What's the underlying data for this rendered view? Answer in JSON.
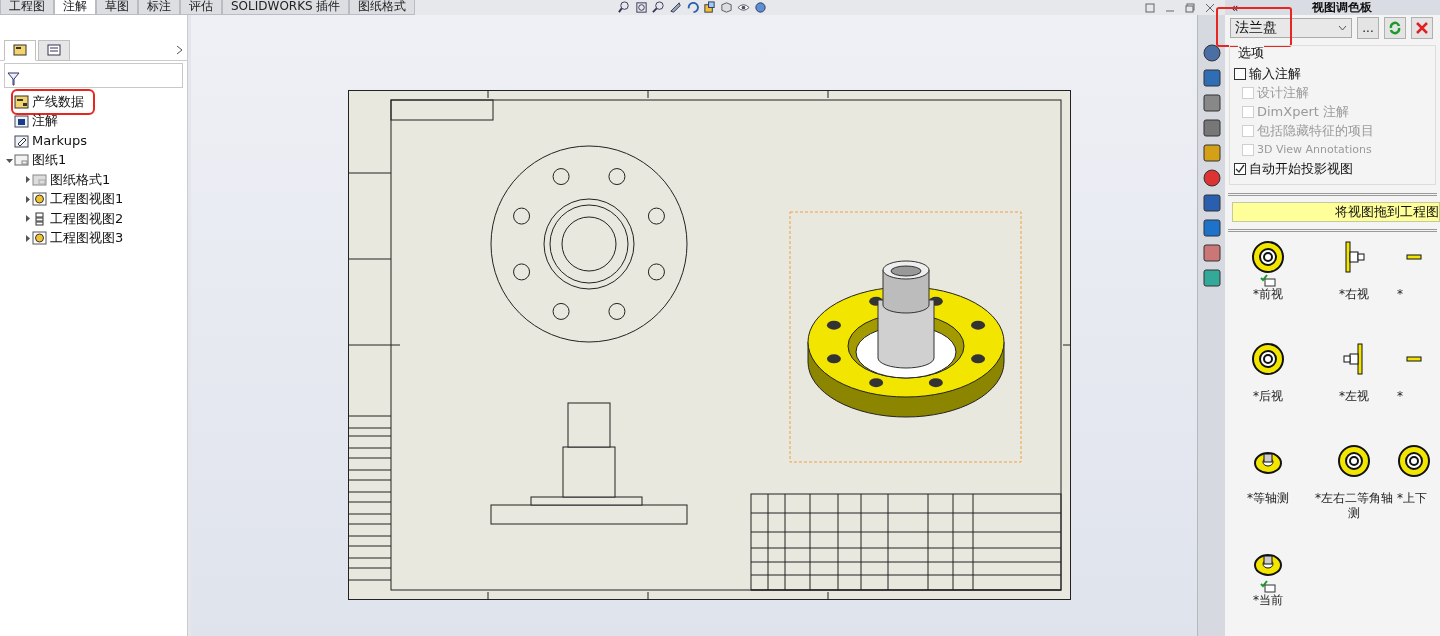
{
  "command_tabs": [
    {
      "label": "工程图",
      "selected": false
    },
    {
      "label": "注解",
      "selected": true
    },
    {
      "label": "草图",
      "selected": false
    },
    {
      "label": "标注",
      "selected": false
    },
    {
      "label": "评估",
      "selected": false
    },
    {
      "label": "SOLIDWORKS 插件",
      "selected": false
    },
    {
      "label": "图纸格式",
      "selected": false
    }
  ],
  "feature_manager": {
    "tabs": [
      {
        "kind": "feature",
        "selected": true
      },
      {
        "kind": "property",
        "selected": false
      }
    ],
    "tree": [
      {
        "label": "产线数据",
        "kind": "drawing",
        "highlighted": true
      },
      {
        "label": "注解",
        "kind": "annotation"
      },
      {
        "label": "Markups",
        "kind": "markup"
      },
      {
        "label": "图纸1",
        "kind": "sheet",
        "expanded": true,
        "children": [
          {
            "label": "图纸格式1",
            "kind": "format",
            "expanded": false
          },
          {
            "label": "工程图视图1",
            "kind": "view",
            "expanded": false
          },
          {
            "label": "工程图视图2",
            "kind": "section",
            "expanded": false
          },
          {
            "label": "工程图视图3",
            "kind": "view",
            "expanded": false
          }
        ]
      }
    ]
  },
  "view_palette": {
    "title": "视图调色板",
    "collapse": "«",
    "model": {
      "value": "法兰盘",
      "highlighted": true
    },
    "browse": "...",
    "options_title": "选项",
    "options": [
      {
        "label": "输入注解",
        "checked": false,
        "disabled": false,
        "indented": false
      },
      {
        "label": "设计注解",
        "checked": false,
        "disabled": true,
        "indented": true
      },
      {
        "label": "DimXpert 注解",
        "checked": false,
        "disabled": true,
        "indented": true
      },
      {
        "label": "包括隐藏特征的项目",
        "checked": false,
        "disabled": true,
        "indented": true
      },
      {
        "label": "3D View Annotations",
        "checked": false,
        "disabled": true,
        "indented": true
      },
      {
        "label": "自动开始投影视图",
        "checked": true,
        "disabled": false,
        "indented": false
      }
    ],
    "hint": "将视图拖到工程图",
    "views": [
      {
        "label": "*前视",
        "kind": "front",
        "in_drawing": true
      },
      {
        "label": "*右视",
        "kind": "right",
        "in_drawing": false
      },
      {
        "label": "*",
        "kind": "top",
        "in_drawing": false
      },
      {
        "label": "*后视",
        "kind": "front",
        "in_drawing": false
      },
      {
        "label": "*左视",
        "kind": "left",
        "in_drawing": false
      },
      {
        "label": "*",
        "kind": "top",
        "in_drawing": false
      },
      {
        "label": "*等轴测",
        "kind": "iso",
        "in_drawing": false
      },
      {
        "label": "*左右二等角轴测",
        "kind": "front",
        "in_drawing": false
      },
      {
        "label": "*上下",
        "kind": "front",
        "in_drawing": false
      },
      {
        "label": "*当前",
        "kind": "iso",
        "in_drawing": true
      }
    ]
  }
}
